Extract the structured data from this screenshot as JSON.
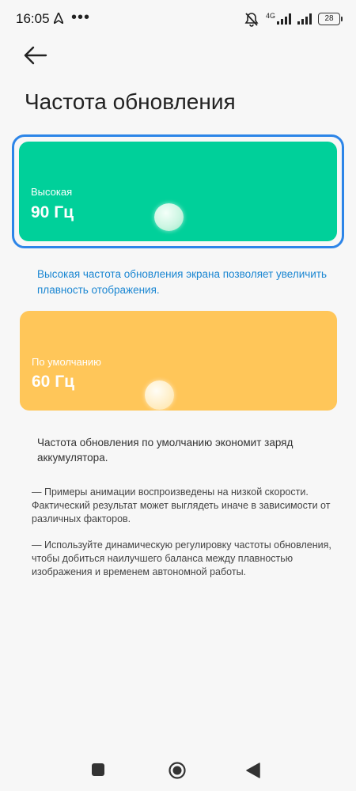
{
  "status_bar": {
    "time": "16:05",
    "more_indicator": "•••",
    "network_label": "4G",
    "battery": "28"
  },
  "header": {
    "back_icon": "arrow-left-icon",
    "title": "Частота обновления"
  },
  "options": {
    "high": {
      "mode": "Высокая",
      "rate": "90 Гц",
      "selected": true,
      "color": "#00d09a"
    },
    "default": {
      "mode": "По умолчанию",
      "rate": "60 Гц",
      "selected": false,
      "color": "#ffc659"
    }
  },
  "descriptions": {
    "high": "Высокая частота обновления экрана позволяет увеличить плавность отображения.",
    "default": "Частота обновления по умолчанию экономит заряд аккумулятора."
  },
  "notes": [
    "— Примеры анимации воспроизведены на низкой скорости. Фактический результат может выглядеть иначе в зависимости от различных факторов.",
    "— Используйте динамическую регулировку частоты обновления, чтобы добиться наилучшего баланса между плавностью изображения и временем автономной работы."
  ],
  "colors": {
    "selection_border": "#2d85e8",
    "link_text": "#1a86d2",
    "background": "#f7f7f7"
  },
  "nav_bar": {
    "recents_icon": "square-icon",
    "home_icon": "circle-home-icon",
    "back_icon": "triangle-back-icon"
  }
}
